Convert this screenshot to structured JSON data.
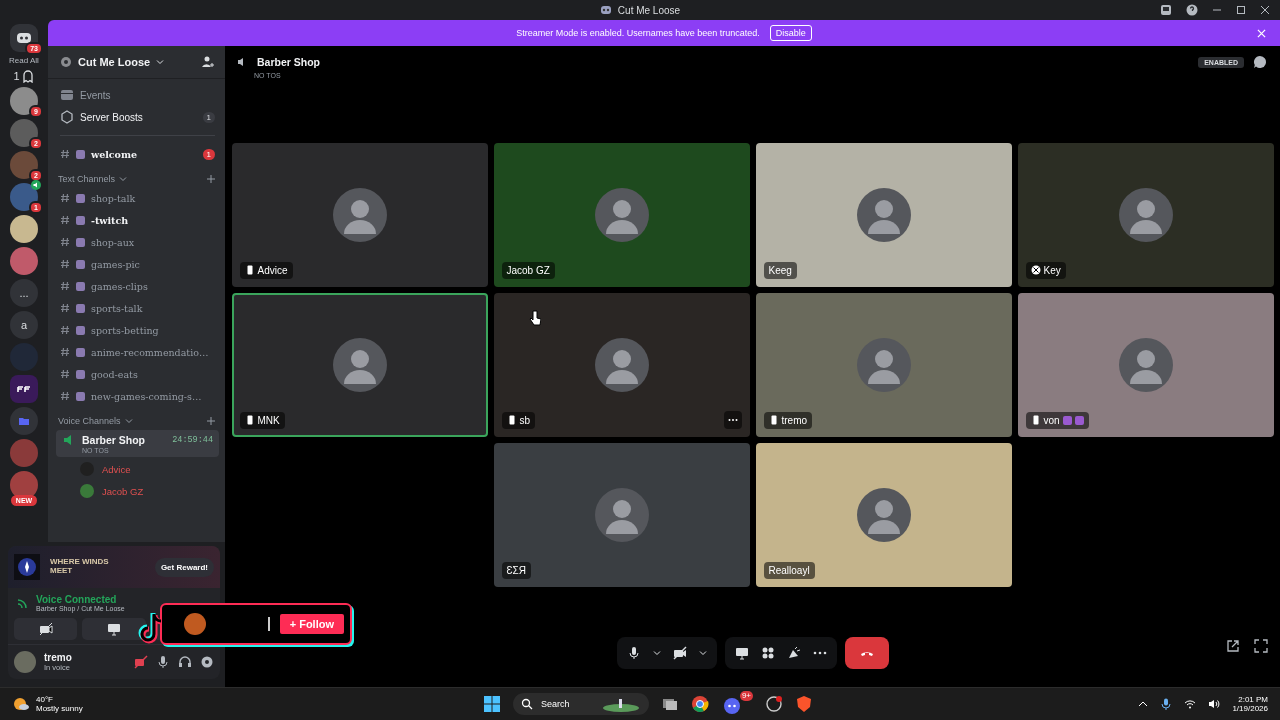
{
  "window": {
    "title": "Cut Me Loose"
  },
  "banner": {
    "text": "Streamer Mode is enabled. Usernames have been truncated.",
    "button": "Disable"
  },
  "rail": [
    {
      "kind": "home",
      "badge": "73"
    },
    {
      "kind": "label",
      "text": "Read All"
    },
    {
      "kind": "ghost",
      "text": "1"
    },
    {
      "kind": "server",
      "badge": "9",
      "color": "#8c8c8c",
      "voice": false
    },
    {
      "kind": "server",
      "badge": "2",
      "color": "#5c5c5c",
      "voice": false
    },
    {
      "kind": "server",
      "badge": "2",
      "color": "#6b4a3a",
      "voice": false
    },
    {
      "kind": "server",
      "badge": "1",
      "color": "#3a5a8a",
      "voice": true
    },
    {
      "kind": "server",
      "color": "#c8b890",
      "voice": false
    },
    {
      "kind": "server",
      "color": "#c05a6a",
      "voice": false
    },
    {
      "kind": "more",
      "text": "..."
    },
    {
      "kind": "letter",
      "text": "a"
    },
    {
      "kind": "server",
      "color": "#202838",
      "voice": false
    },
    {
      "kind": "brand",
      "color": "#3a1a5a"
    },
    {
      "kind": "folder"
    },
    {
      "kind": "server",
      "color": "#8a3a3a",
      "voice": false
    },
    {
      "kind": "server",
      "color": "#a04040",
      "voice": false,
      "pill": "NEW"
    }
  ],
  "server": {
    "name": "Cut Me Loose"
  },
  "top_items": [
    {
      "kind": "events",
      "label": "Events"
    },
    {
      "kind": "boosts",
      "label": "Server Boosts",
      "count": "1"
    }
  ],
  "welcome": {
    "name": "welcome",
    "badge": "1",
    "unread": true
  },
  "text_category": "Text Channels",
  "channels": [
    {
      "name": "shop-talk",
      "unread": false
    },
    {
      "name": "-twitch",
      "unread": true
    },
    {
      "name": "shop-aux",
      "unread": false
    },
    {
      "name": "games-pic",
      "unread": false
    },
    {
      "name": "games-clips",
      "unread": false
    },
    {
      "name": "sports-talk",
      "unread": false
    },
    {
      "name": "sports-betting",
      "unread": false
    },
    {
      "name": "anime-recommendatio…",
      "unread": false
    },
    {
      "name": "good-eats",
      "unread": false
    },
    {
      "name": "new-games-coming-s…",
      "unread": false
    }
  ],
  "voice_category": "Voice Channels",
  "voice_channel": {
    "name": "Barber Shop",
    "timer": "24:59:44",
    "topic": "NO TOS",
    "selected": true,
    "members": [
      {
        "name": "Advice",
        "color": "#202020"
      },
      {
        "name": "Jacob GZ",
        "color": "#3a7a3a"
      }
    ]
  },
  "promo": {
    "logo": "WHERE WINDS MEET",
    "button": "Get Reward!"
  },
  "voice_panel": {
    "status": "Voice Connected",
    "location": "Barber Shop / Cut Me Loose"
  },
  "user": {
    "name": "tremo",
    "status": "In voice"
  },
  "header": {
    "channel": "Barber Shop",
    "topic": "NO TOS",
    "badge": "ENABLED"
  },
  "tiles": [
    {
      "name": "Advice",
      "kind": "phone",
      "color": "#2a2a2c",
      "selected": false,
      "menu": false
    },
    {
      "name": "Jacob GZ",
      "kind": "plain",
      "color": "#1e4a1e",
      "selected": false,
      "menu": false
    },
    {
      "name": "Keeg",
      "kind": "plain",
      "color": "#b4b2a6",
      "selected": false,
      "menu": false
    },
    {
      "name": "Key",
      "kind": "xbox",
      "color": "#2c2e24",
      "selected": false,
      "menu": false
    },
    {
      "name": "MNK",
      "kind": "phone",
      "color": "#2a2a2c",
      "selected": true,
      "menu": false
    },
    {
      "name": "sb",
      "kind": "phone",
      "color": "#2a2624",
      "selected": false,
      "menu": true
    },
    {
      "name": "tremo",
      "kind": "phone",
      "color": "#6a6a5c",
      "selected": false,
      "menu": false
    },
    {
      "name": "von",
      "kind": "phone",
      "color": "#8a7c80",
      "selected": false,
      "menu": false,
      "emoji_badges": true
    },
    {
      "name": "ƐΣЯ",
      "kind": "plain",
      "color": "#3a3e42",
      "selected": false,
      "menu": false
    },
    {
      "name": "Realloayl",
      "kind": "plain",
      "color": "#c4b48c",
      "selected": false,
      "menu": false
    }
  ],
  "controls": {
    "camera_on": false
  },
  "overlay": {
    "button": "+ Follow"
  },
  "taskbar": {
    "temperature": "40°F",
    "weather": "Mostly sunny",
    "search": "Search",
    "discord_badge": "9+",
    "time": "2:01 PM",
    "date": "1/19/2026"
  }
}
